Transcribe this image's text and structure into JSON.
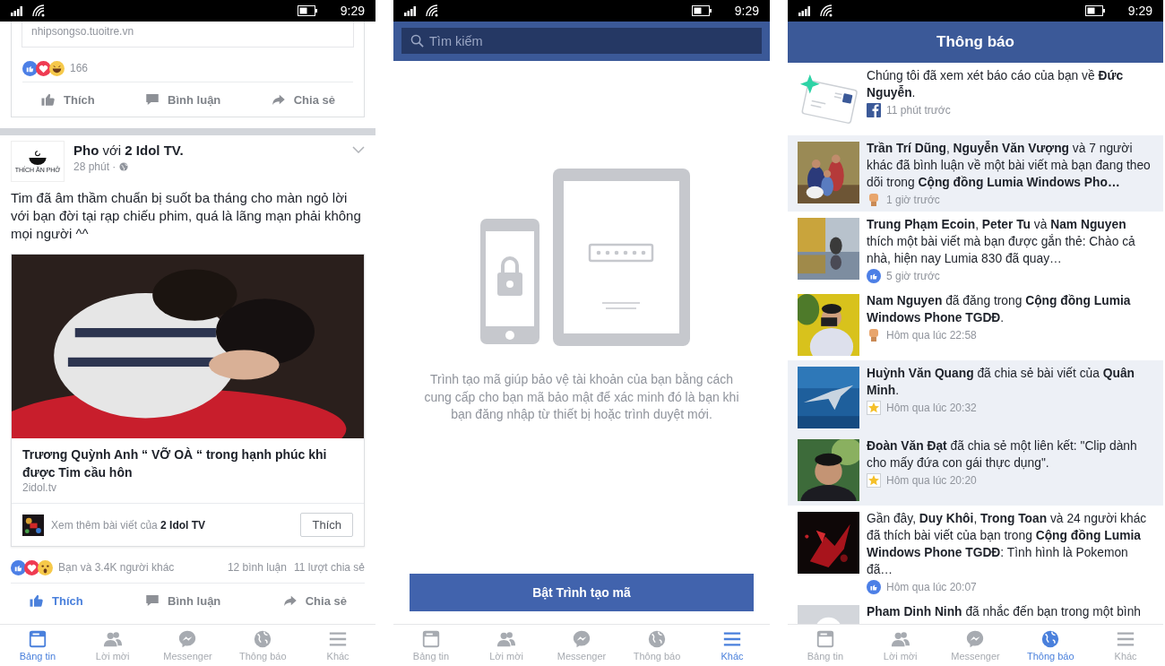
{
  "feed_screen": {
    "status_bar": {
      "time": "9:29"
    },
    "previous_post": {
      "link_domain": "nhipsongso.tuoitre.vn",
      "reactions": [
        {
          "kind": "like"
        },
        {
          "kind": "love"
        },
        {
          "kind": "haha"
        }
      ],
      "reaction_count": "166",
      "actions": [
        {
          "kind": "like",
          "label": "Thích",
          "selected": false
        },
        {
          "kind": "comment",
          "label": "Bình luận",
          "selected": false
        },
        {
          "kind": "share",
          "label": "Chia sẻ",
          "selected": false
        }
      ]
    },
    "post": {
      "page_logo_text": "THÍCH ĂN PHỞ",
      "header": "**Pho** với **2 Idol TV.**",
      "time": "28 phút ·",
      "text": "Tim đã âm thầm chuẩn bị suốt ba tháng cho màn ngỏ lời với bạn đời tại rạp chiếu phim, quá là lãng mạn phải không mọi người ^^",
      "link_title": "Trương Quỳnh Anh “ VỠ OÀ “ trong hạnh phúc khi được Tim cầu hôn",
      "link_domain": "2idol.tv",
      "page_promo": "Xem thêm bài viết của **2 Idol TV**",
      "page_like_button": "Thích",
      "reactions": [
        {
          "kind": "like"
        },
        {
          "kind": "love"
        },
        {
          "kind": "wow"
        }
      ],
      "reaction_summary": "Bạn và 3.4K người khác",
      "comments": "12 bình luận",
      "shares": "11 lượt chia sẻ",
      "actions": [
        {
          "kind": "like",
          "label": "Thích",
          "selected": true
        },
        {
          "kind": "comment",
          "label": "Bình luận",
          "selected": false
        },
        {
          "kind": "share",
          "label": "Chia sẻ",
          "selected": false
        }
      ]
    },
    "nav_tabs": [
      {
        "kind": "feed",
        "label": "Bảng tin",
        "selected": true
      },
      {
        "kind": "friends",
        "label": "Lời mời",
        "selected": false
      },
      {
        "kind": "messenger",
        "label": "Messenger",
        "selected": false
      },
      {
        "kind": "globe",
        "label": "Thông báo",
        "selected": false
      },
      {
        "kind": "menu",
        "label": "Khác",
        "selected": false
      }
    ]
  },
  "code_generator_screen": {
    "status_bar": {
      "time": "9:29"
    },
    "search": {
      "placeholder": "Tìm kiếm"
    },
    "description": "Trình tạo mã giúp bảo vệ tài khoản của bạn bằng cách cung cấp cho bạn mã bảo mật để xác minh đó là bạn khi bạn đăng nhập từ thiết bị hoặc trình duyệt mới.",
    "button": "Bật Trình tạo mã",
    "nav_tabs": [
      {
        "kind": "feed",
        "label": "Bảng tin",
        "selected": false
      },
      {
        "kind": "friends",
        "label": "Lời mời",
        "selected": false
      },
      {
        "kind": "messenger",
        "label": "Messenger",
        "selected": false
      },
      {
        "kind": "globe",
        "label": "Thông báo",
        "selected": false
      },
      {
        "kind": "menu",
        "label": "Khác",
        "selected": true
      }
    ]
  },
  "notifications_screen": {
    "status_bar": {
      "time": "9:29"
    },
    "title": "Thông báo",
    "notifications": [
      {
        "avatar": {
          "kind": "envelope"
        },
        "text": "Chúng tôi đã xem xét báo cáo của bạn về **Đức Nguyễn**.",
        "badge": {
          "kind": "facebook"
        },
        "time": "11 phút trước",
        "unread": false
      },
      {
        "text": "**Trần Trí Dũng**, **Nguyễn Văn Vượng** và 7 người khác đã bình luận về một bài viết mà bạn đang theo dõi trong **Cộng đồng Lumia Windows Pho…**",
        "badge": {
          "kind": "fist"
        },
        "time": "1 giờ trước",
        "unread": true
      },
      {
        "text": "**Trung Phạm Ecoin**, **Peter Tu** và **Nam Nguyen** thích một bài viết mà bạn được gắn thẻ: Chào cả nhà, hiện nay Lumia 830 đã quay…",
        "badge": {
          "kind": "like"
        },
        "time": "5 giờ trước",
        "unread": false
      },
      {
        "text": "**Nam Nguyen** đã đăng trong **Cộng đồng Lumia Windows Phone TGDĐ**.",
        "badge": {
          "kind": "fist"
        },
        "time": "Hôm qua lúc 22:58",
        "unread": false
      },
      {
        "text": "**Huỳnh Văn Quang** đã chia sẻ bài viết của **Quân Minh**.",
        "badge": {
          "kind": "star"
        },
        "time": "Hôm qua lúc 20:32",
        "unread": true
      },
      {
        "text": "**Đoàn Văn Đạt** đã chia sẻ một liên kết: \"Clip dành cho mấy đứa con gái thực dụng\".",
        "badge": {
          "kind": "star"
        },
        "time": "Hôm qua lúc 20:20",
        "unread": true
      },
      {
        "text": "Gần đây, **Duy Khôi**, **Trong Toan** và 24 người khác đã thích bài viết của bạn trong **Cộng đồng Lumia Windows Phone TGDĐ**: Tình hình là Pokemon đã…",
        "badge": {
          "kind": "like"
        },
        "time": "Hôm qua lúc 20:07",
        "unread": false
      },
      {
        "avatar": {
          "kind": "placeholder"
        },
        "text": "**Pham Dinh Ninh** đã nhắc đến bạn trong một bình",
        "unread": false
      }
    ],
    "nav_tabs": [
      {
        "kind": "feed",
        "label": "Bảng tin",
        "selected": false
      },
      {
        "kind": "friends",
        "label": "Lời mời",
        "selected": false
      },
      {
        "kind": "messenger",
        "label": "Messenger",
        "selected": false
      },
      {
        "kind": "globe",
        "label": "Thông báo",
        "selected": true
      },
      {
        "kind": "menu",
        "label": "Khác",
        "selected": false
      }
    ]
  }
}
